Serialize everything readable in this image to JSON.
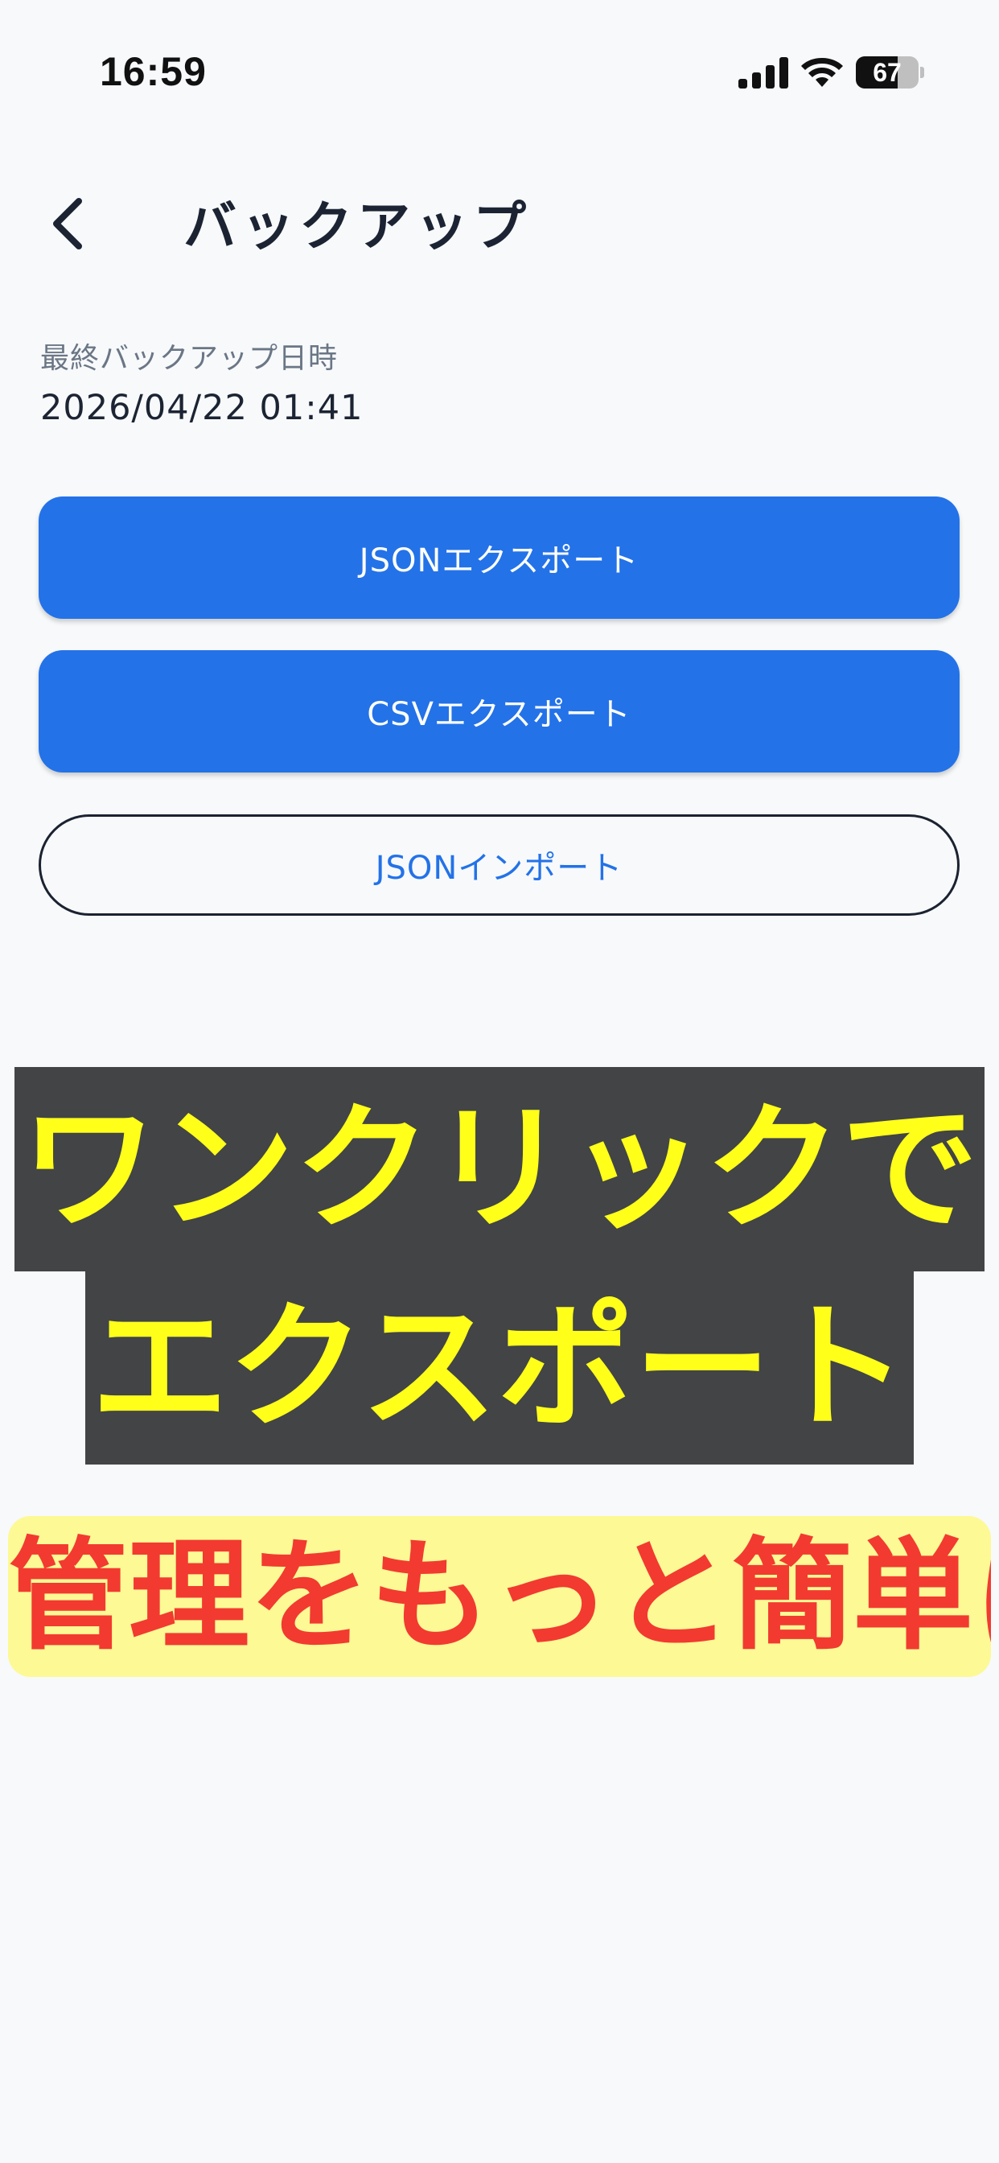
{
  "status_bar": {
    "time": "16:59",
    "battery_level": "67",
    "icons": [
      "signal-icon",
      "wifi-icon",
      "battery-icon"
    ]
  },
  "header": {
    "back_icon": "chevron-left-icon",
    "title": "バックアップ"
  },
  "backup": {
    "last_label": "最終バックアップ日時",
    "last_value": "2026/04/22 01:41"
  },
  "actions": {
    "json_export": "JSONエクスポート",
    "csv_export": "CSVエクスポート",
    "json_import": "JSONインポート"
  },
  "overlay": {
    "line1": "ワンクリックで",
    "line2": "エクスポート",
    "highlight": "管理をもっと簡単に"
  },
  "colors": {
    "background": "#f7f9fb",
    "primary": "#2372e8",
    "caption_bg": "#424446",
    "caption_text": "#ffff1a",
    "highlight_bg": "#fdf995",
    "highlight_text": "#f23a30"
  }
}
